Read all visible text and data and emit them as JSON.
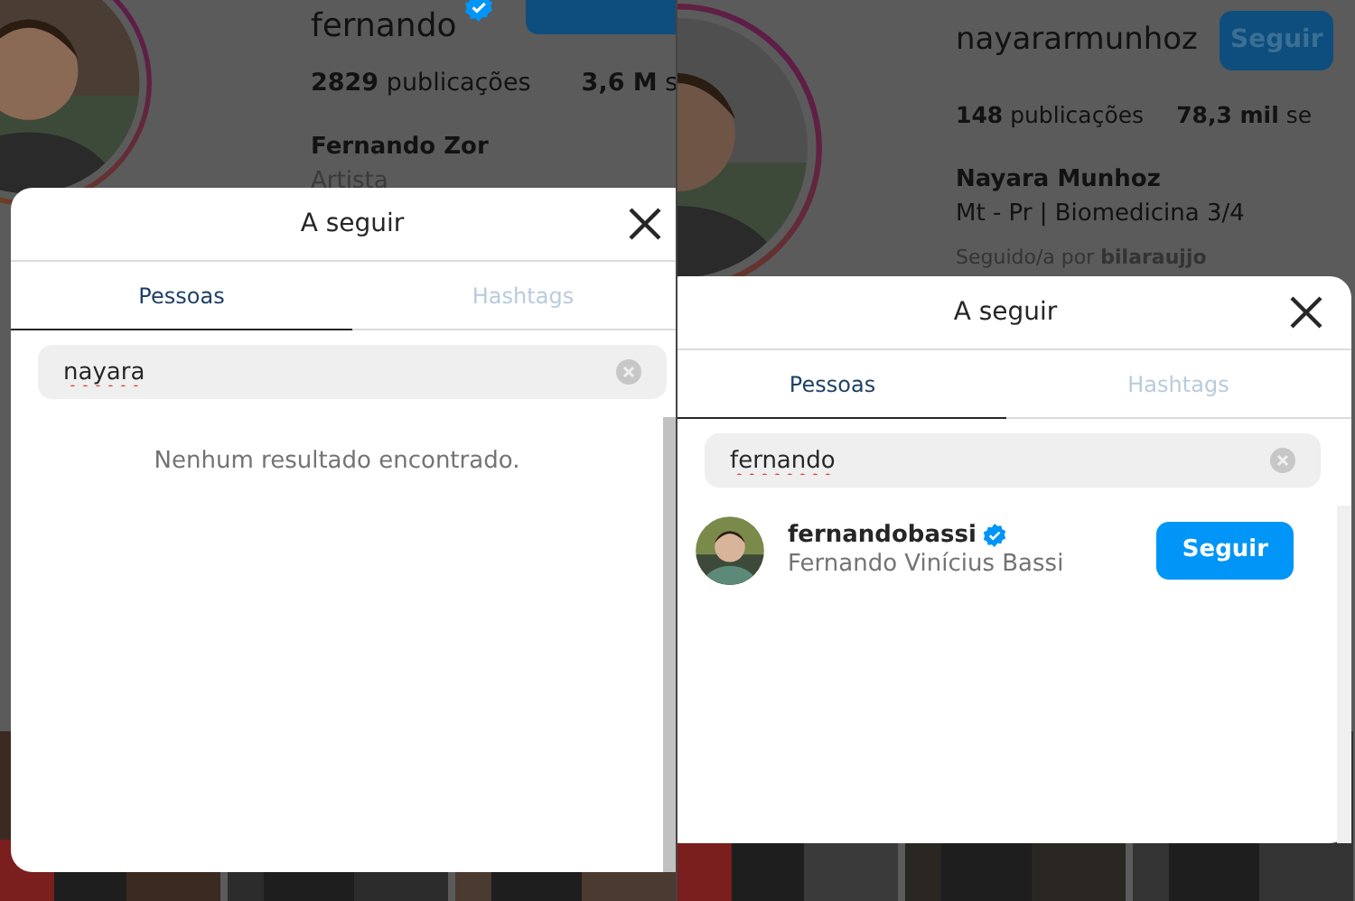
{
  "panels": [
    {
      "profile": {
        "username": "fernando",
        "verified": true,
        "stats": [
          "**2829** publicações",
          "**3,6 M** s"
        ],
        "name": "Fernando Zor",
        "bio": [
          {
            "kind": "category",
            "text": "Artista"
          }
        ]
      },
      "modal": {
        "title": "A seguir",
        "tabs": [
          {
            "label": "Pessoas",
            "selected": true
          },
          {
            "label": "Hashtags",
            "selected": false
          }
        ],
        "search": {
          "value": "nayara"
        },
        "message": "Nenhum resultado encontrado."
      }
    },
    {
      "profile": {
        "username": "nayararmunhoz",
        "verified": false,
        "follow_button": "Seguir",
        "stats": [
          "**148** publicações",
          "**78,3 mil** se"
        ],
        "name": "Nayara Munhoz",
        "bio": [
          {
            "kind": "bio",
            "text": "Mt - Pr | Biomedicina 3/4"
          },
          {
            "kind": "followed_by",
            "text": "Seguido/a por **bilaraujjo**"
          }
        ]
      },
      "modal": {
        "title": "A seguir",
        "tabs": [
          {
            "label": "Pessoas",
            "selected": true
          },
          {
            "label": "Hashtags",
            "selected": false
          }
        ],
        "search": {
          "value": "fernando"
        },
        "results": [
          {
            "username": "fernandobassi",
            "verified": true,
            "full_name": "Fernando Vinícius Bassi",
            "button": "Seguir"
          }
        ]
      }
    }
  ]
}
